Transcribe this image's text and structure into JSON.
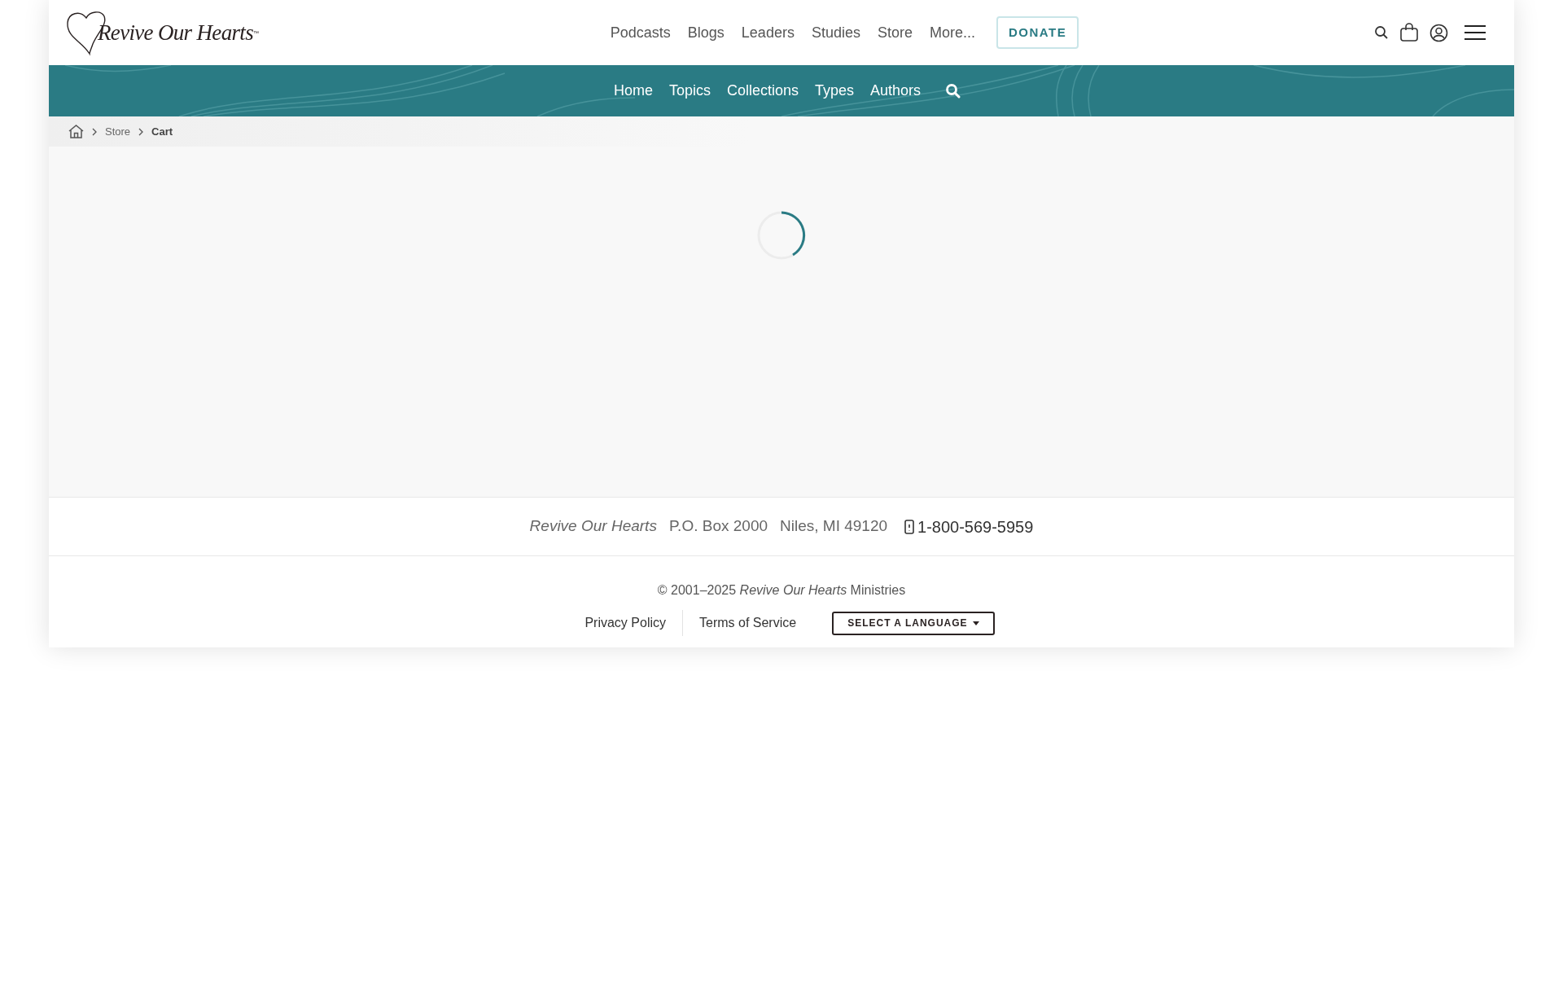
{
  "logo": {
    "text": "Revive Our Hearts",
    "trademark": "™"
  },
  "main_nav": [
    "Podcasts",
    "Blogs",
    "Leaders",
    "Studies",
    "Store",
    "More..."
  ],
  "donate_button": "DONATE",
  "sub_nav": [
    "Home",
    "Topics",
    "Collections",
    "Types",
    "Authors"
  ],
  "breadcrumb": [
    {
      "label": "Store",
      "current": false
    },
    {
      "label": "Cart",
      "current": true
    }
  ],
  "loading": true,
  "footer": {
    "address": [
      "Revive Our Hearts",
      "P.O. Box 2000",
      "Niles, MI 49120"
    ],
    "phone": "1-800-569-5959",
    "copyright": "© 2001–2025 *Revive Our Hearts* Ministries",
    "links": [
      "Privacy Policy",
      "Terms of Service"
    ],
    "language_button": "SELECT A LANGUAGE"
  }
}
